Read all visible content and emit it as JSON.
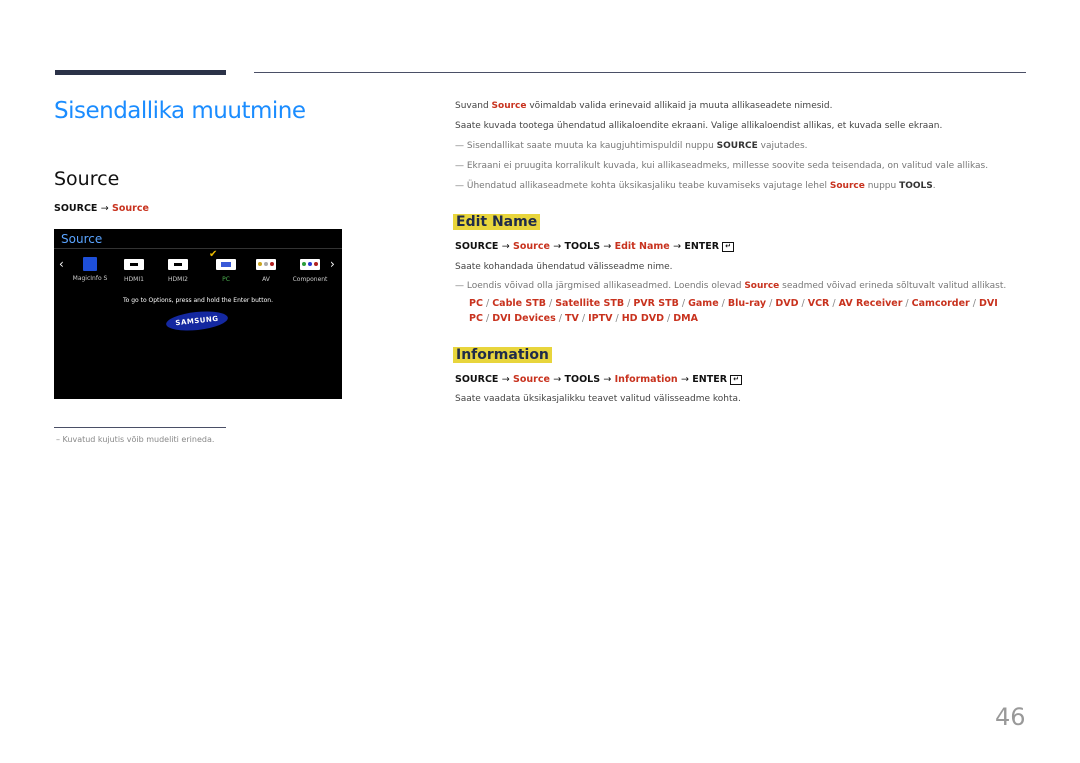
{
  "page": {
    "title": "Sisendallika muutmine",
    "section": "Source",
    "page_number": "46"
  },
  "left": {
    "path": {
      "source": "SOURCE",
      "arrow": "→",
      "target": "Source"
    },
    "screen": {
      "title": "Source",
      "items": [
        {
          "label": "MagicInfo S",
          "icon": "magicinfo-icon",
          "selected": false
        },
        {
          "label": "HDMI1",
          "icon": "hdmi-icon",
          "selected": false
        },
        {
          "label": "HDMI2",
          "icon": "hdmi-icon",
          "selected": false
        },
        {
          "label": "PC",
          "icon": "pc-icon",
          "selected": true
        },
        {
          "label": "AV",
          "icon": "av-icon",
          "selected": false
        },
        {
          "label": "Component",
          "icon": "component-icon",
          "selected": false
        }
      ],
      "hint": "To go to Options, press and hold the Enter button.",
      "logo": "SAMSUNG",
      "selected_color": "#4caf50",
      "check_color": "#e8b800"
    },
    "footnote": "Kuvatud kujutis võib mudeliti erineda."
  },
  "right": {
    "intro1_pre": "Suvand ",
    "intro1_hl": "Source",
    "intro1_post": " võimaldab valida erinevaid allikaid ja muuta allikaseadete nimesid.",
    "intro2": "Saate kuvada tootega ühendatud allikaloendite ekraani. Valige allikaloendist allikas, et kuvada selle ekraan.",
    "note1_pre": "Sisendallikat saate muuta ka kaugjuhtimispuldil nuppu ",
    "note1_b": "SOURCE",
    "note1_post": " vajutades.",
    "note2": "Ekraani ei pruugita korralikult kuvada, kui allikaseadmeks, millesse soovite seda teisendada, on valitud vale allikas.",
    "note3_pre": "Ühendatud allikaseadmete kohta üksikasjaliku teabe kuvamiseks vajutage lehel ",
    "note3_hl": "Source",
    "note3_mid": " nuppu ",
    "note3_b": "TOOLS",
    "note3_post": ".",
    "edit": {
      "heading": "Edit Name",
      "path": [
        "SOURCE",
        "Source",
        "TOOLS",
        "Edit Name",
        "ENTER"
      ],
      "desc": "Saate kohandada ühendatud välisseadme nime.",
      "note_pre": "Loendis võivad olla järgmised allikaseadmed. Loendis olevad ",
      "note_hl": "Source",
      "note_post": " seadmed võivad erineda sõltuvalt valitud allikast.",
      "devices": [
        "PC",
        "Cable STB",
        "Satellite STB",
        "PVR STB",
        "Game",
        "Blu-ray",
        "DVD",
        "VCR",
        "AV Receiver",
        "Camcorder",
        "DVI PC",
        "DVI Devices",
        "TV",
        "IPTV",
        "HD DVD",
        "DMA"
      ]
    },
    "info": {
      "heading": "Information",
      "path": [
        "SOURCE",
        "Source",
        "TOOLS",
        "Information",
        "ENTER"
      ],
      "desc": "Saate vaadata üksikasjalikku teavet valitud välisseadme kohta."
    },
    "arrow": "→",
    "separator": "/"
  },
  "colors": {
    "title_blue": "#1a8cff",
    "accent_red": "#c8321e",
    "highlight_yellow": "#e8d53c"
  }
}
